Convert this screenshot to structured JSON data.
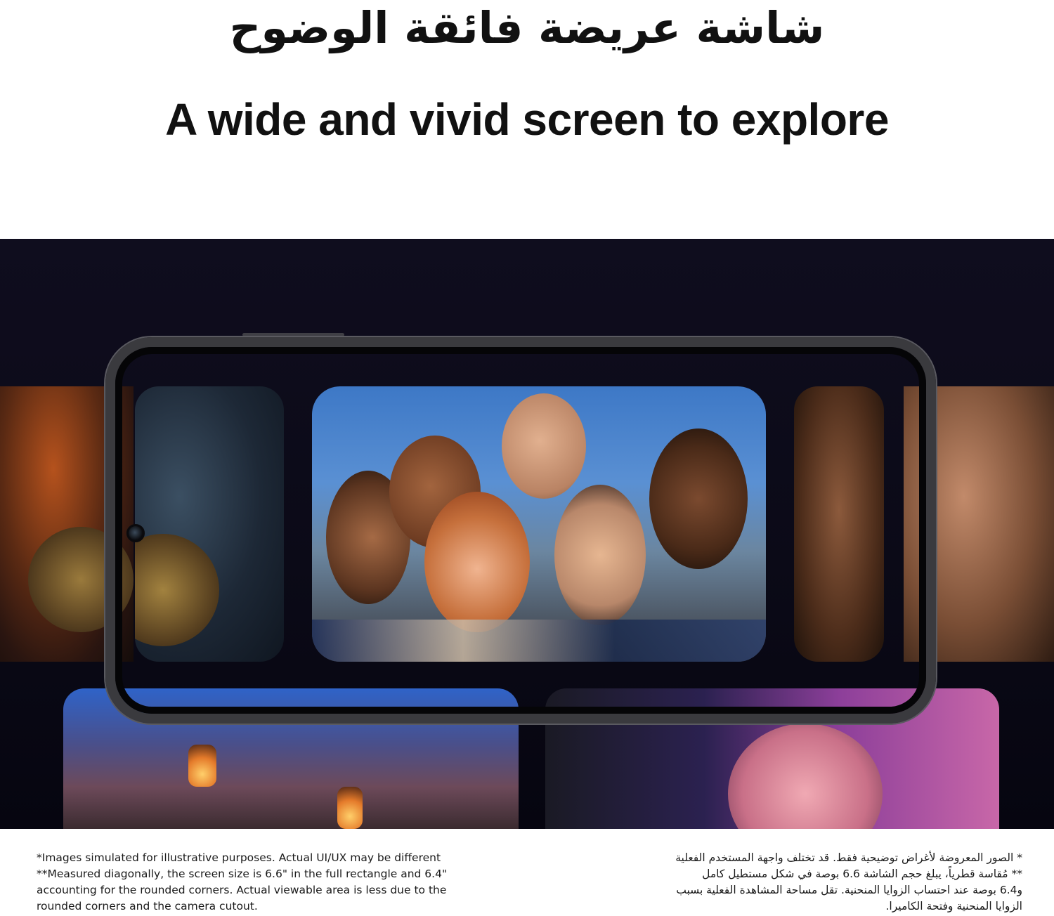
{
  "headline": {
    "arabic": "شاشة عريضة فائقة الوضوح",
    "english": "A wide and vivid screen to explore"
  },
  "footnotes": {
    "english": [
      "*Images simulated for illustrative purposes. Actual UI/UX may be different",
      "**Measured diagonally, the screen size is 6.6\" in the full rectangle and 6.4\"",
      "accounting for the rounded corners. Actual viewable area is less due to the",
      "rounded corners and the camera cutout."
    ],
    "arabic": [
      "* الصور المعروضة لأغراض توضيحية فقط. قد تختلف واجهة المستخدم الفعلية",
      "** مُقاسة قطرياً، يبلغ حجم الشاشة 6.6 بوصة في شكل مستطيل كامل",
      "و6.4 بوصة عند احتساب الزوايا المنحنية. تقل مساحة المشاهدة الفعلية بسبب",
      "الزوايا المنحنية وفتحة الكاميرا."
    ]
  },
  "colors": {
    "background": "#ffffff",
    "hero_background": "#0b0a17",
    "phone_frame": "#3a3a3e",
    "text": "#111111"
  }
}
